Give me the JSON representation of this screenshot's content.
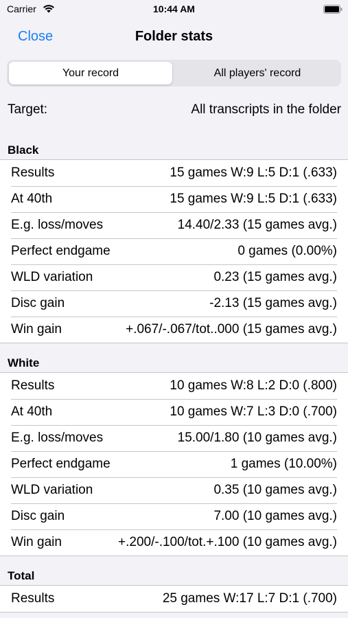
{
  "status_bar": {
    "carrier": "Carrier",
    "time": "10:44 AM"
  },
  "nav": {
    "close": "Close",
    "title": "Folder stats"
  },
  "segments": [
    "Your record",
    "All players' record"
  ],
  "target": {
    "label": "Target:",
    "value": "All transcripts in the folder"
  },
  "sections": [
    {
      "title": "Black",
      "rows": [
        {
          "label": "Results",
          "value": "15 games W:9 L:5 D:1 (.633)"
        },
        {
          "label": "At 40th",
          "value": "15 games W:9 L:5 D:1 (.633)"
        },
        {
          "label": "E.g. loss/moves",
          "value": "14.40/2.33 (15 games avg.)"
        },
        {
          "label": "Perfect endgame",
          "value": "0 games (0.00%)"
        },
        {
          "label": "WLD variation",
          "value": "0.23 (15 games avg.)"
        },
        {
          "label": "Disc gain",
          "value": "-2.13 (15 games avg.)"
        },
        {
          "label": "Win gain",
          "value": "+.067/-.067/tot..000 (15 games avg.)"
        }
      ]
    },
    {
      "title": "White",
      "rows": [
        {
          "label": "Results",
          "value": "10 games W:8 L:2 D:0 (.800)"
        },
        {
          "label": "At 40th",
          "value": "10 games W:7 L:3 D:0 (.700)"
        },
        {
          "label": "E.g. loss/moves",
          "value": "15.00/1.80 (10 games avg.)"
        },
        {
          "label": "Perfect endgame",
          "value": "1 games (10.00%)"
        },
        {
          "label": "WLD variation",
          "value": "0.35 (10 games avg.)"
        },
        {
          "label": "Disc gain",
          "value": "7.00 (10 games avg.)"
        },
        {
          "label": "Win gain",
          "value": "+.200/-.100/tot.+.100 (10 games avg.)"
        }
      ]
    },
    {
      "title": "Total",
      "rows": [
        {
          "label": "Results",
          "value": "25 games W:17 L:7 D:1 (.700)"
        }
      ]
    }
  ]
}
